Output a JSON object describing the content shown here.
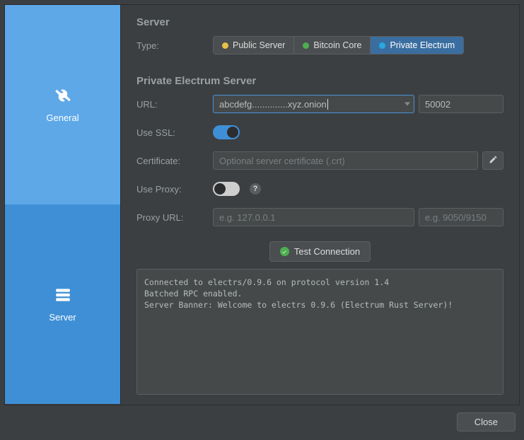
{
  "sidebar": {
    "items": [
      {
        "label": "General"
      },
      {
        "label": "Server"
      }
    ]
  },
  "server_section": {
    "title": "Server",
    "type_label": "Type:",
    "type_options": [
      {
        "label": "Public Server",
        "dot_color": "#e6c04a"
      },
      {
        "label": "Bitcoin Core",
        "dot_color": "#4caf50"
      },
      {
        "label": "Private Electrum",
        "dot_color": "#2aa7de"
      }
    ]
  },
  "private_section": {
    "title": "Private Electrum Server",
    "url_label": "URL:",
    "url_value": "abcdefg..............xyz.onion",
    "port_value": "50002",
    "ssl_label": "Use SSL:",
    "cert_label": "Certificate:",
    "cert_placeholder": "Optional server certificate (.crt)",
    "proxy_label": "Use Proxy:",
    "proxy_url_label": "Proxy URL:",
    "proxy_host_placeholder": "e.g. 127.0.0.1",
    "proxy_port_placeholder": "e.g. 9050/9150",
    "test_label": "Test Connection"
  },
  "log_text": "Connected to electrs/0.9.6 on protocol version 1.4\nBatched RPC enabled.\nServer Banner: Welcome to electrs 0.9.6 (Electrum Rust Server)!",
  "footer": {
    "close_label": "Close"
  }
}
